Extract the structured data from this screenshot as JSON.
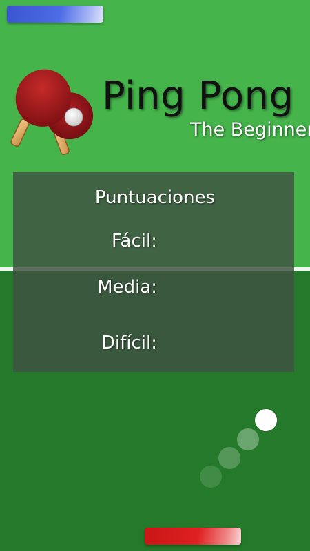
{
  "game": {
    "title": "Ping Pong",
    "subtitle": "The Beginner"
  },
  "scores": {
    "heading": "Puntuaciones",
    "easy_label": "Fácil:",
    "easy_value": "",
    "medium_label": "Media:",
    "medium_value": "",
    "hard_label": "Difícil:",
    "hard_value": ""
  },
  "colors": {
    "table_top": "#45b44b",
    "table_bottom": "#247a2a",
    "player_top_paddle": "#4d6ce6",
    "player_bottom_paddle": "#df2020",
    "ball": "#ffffff",
    "panel": "#405042"
  },
  "icons": {
    "logo": "ping-pong-paddles-icon"
  }
}
